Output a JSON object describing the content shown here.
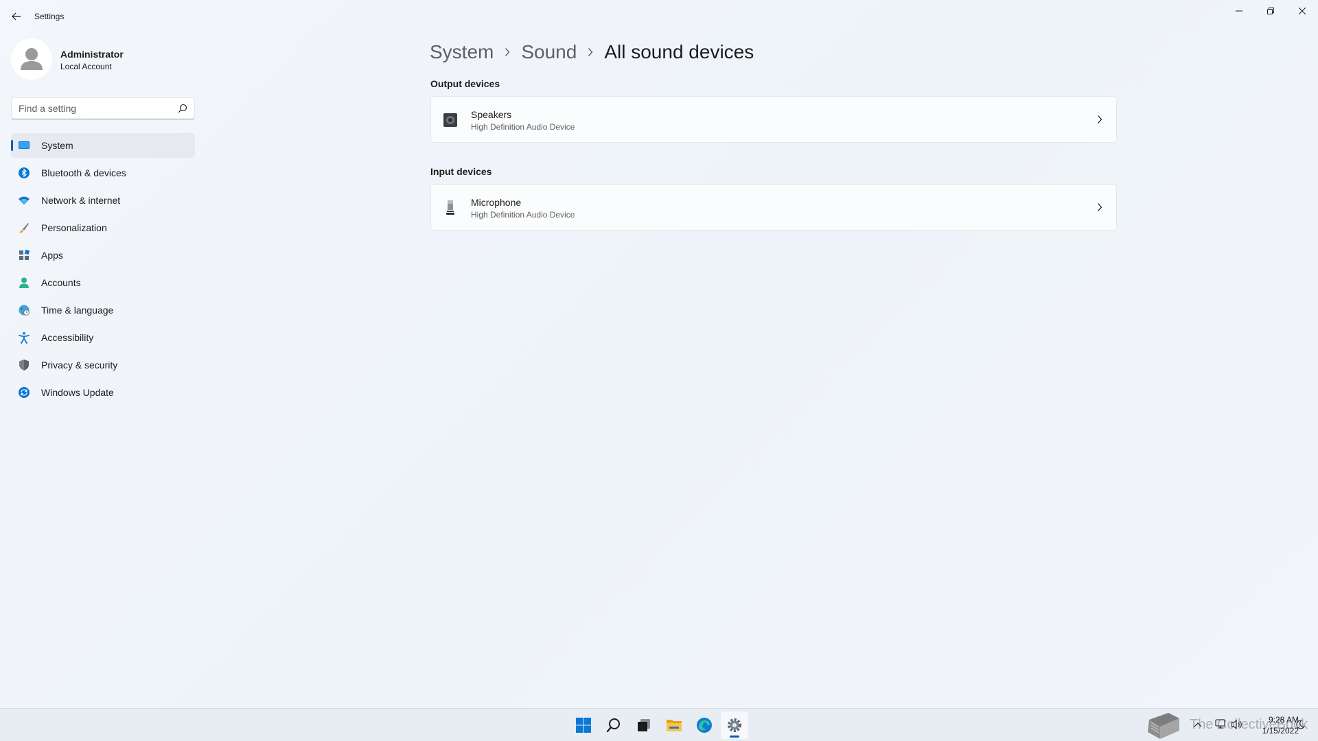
{
  "window": {
    "title": "Settings",
    "back_label": "Back",
    "minimize": "Minimize",
    "restore": "Restore",
    "close": "Close"
  },
  "profile": {
    "name": "Administrator",
    "account_type": "Local Account"
  },
  "search": {
    "placeholder": "Find a setting",
    "value": ""
  },
  "nav": {
    "items": [
      {
        "label": "System",
        "icon": "monitor-icon",
        "active": true
      },
      {
        "label": "Bluetooth & devices",
        "icon": "bluetooth-icon"
      },
      {
        "label": "Network & internet",
        "icon": "wifi-icon"
      },
      {
        "label": "Personalization",
        "icon": "brush-icon"
      },
      {
        "label": "Apps",
        "icon": "apps-icon"
      },
      {
        "label": "Accounts",
        "icon": "person-icon"
      },
      {
        "label": "Time & language",
        "icon": "globe-clock-icon"
      },
      {
        "label": "Accessibility",
        "icon": "accessibility-icon"
      },
      {
        "label": "Privacy & security",
        "icon": "shield-icon"
      },
      {
        "label": "Windows Update",
        "icon": "update-icon"
      }
    ]
  },
  "breadcrumb": {
    "items": [
      "System",
      "Sound"
    ],
    "current": "All sound devices"
  },
  "sections": {
    "output": {
      "title": "Output devices",
      "devices": [
        {
          "name": "Speakers",
          "description": "High Definition Audio Device",
          "icon": "speaker-icon"
        }
      ]
    },
    "input": {
      "title": "Input devices",
      "devices": [
        {
          "name": "Microphone",
          "description": "High Definition Audio Device",
          "icon": "microphone-icon"
        }
      ]
    }
  },
  "taskbar": {
    "apps": [
      "start-icon",
      "search-icon",
      "task-view-icon",
      "file-explorer-icon",
      "edge-icon",
      "settings-icon"
    ],
    "tray": [
      "chevron-up-icon",
      "network-icon",
      "volume-icon"
    ],
    "time": "9:28 AM",
    "date": "1/15/2022",
    "watermark": "The CollectiveBook"
  },
  "colors": {
    "accent": "#005fb8",
    "background": "#eef3f9",
    "card": "#fbfcfd"
  }
}
